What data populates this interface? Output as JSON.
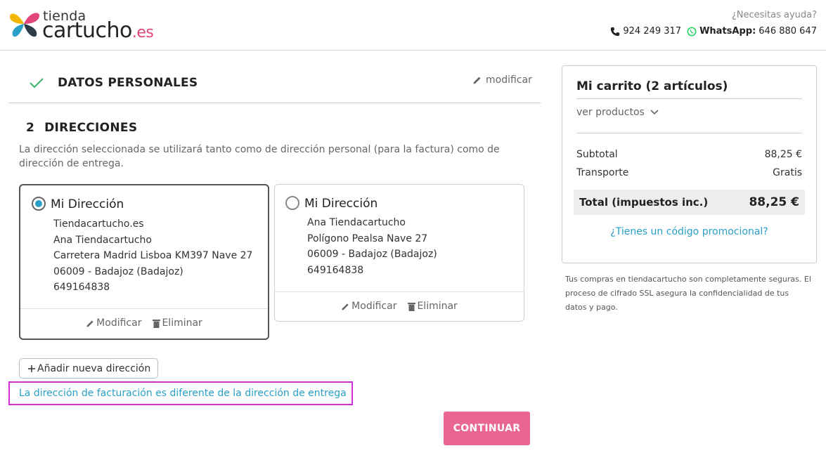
{
  "header": {
    "logo_small": "tienda",
    "logo_big": "cartucho",
    "logo_tld": ".es",
    "help_text": "¿Necesitas ayuda?",
    "phone": "924 249 317",
    "whatsapp_label": "WhatsApp:",
    "whatsapp_number": "646 880 647"
  },
  "step1": {
    "title": "DATOS PERSONALES",
    "modify_label": "modificar"
  },
  "step2": {
    "number": "2",
    "title": "DIRECCIONES",
    "description": "La dirección seleccionada se utilizará tanto como de dirección personal (para la factura) como de dirección de entrega."
  },
  "addresses": [
    {
      "alias": "Mi Dirección",
      "selected": true,
      "lines": [
        "Tiendacartucho.es",
        "Ana Tiendacartucho",
        "Carretera Madrid Lisboa KM397 Nave 27",
        "06009 - Badajoz (Badajoz)",
        "649164838"
      ],
      "edit_label": "Modificar",
      "delete_label": "Eliminar"
    },
    {
      "alias": "Mi Dirección",
      "selected": false,
      "lines": [
        "Ana Tiendacartucho",
        "Polígono Pealsa Nave 27",
        "06009 - Badajoz (Badajoz)",
        "649164838"
      ],
      "edit_label": "Modificar",
      "delete_label": "Eliminar"
    }
  ],
  "add_address_label": "Añadir nueva dirección",
  "billing_different_label": "La dirección de facturación es diferente de la dirección de entrega",
  "continue_label": "CONTINUAR",
  "cart": {
    "title": "Mi carrito (2 artículos)",
    "view_products": "ver productos",
    "subtotal_label": "Subtotal",
    "subtotal_value": "88,25 €",
    "shipping_label": "Transporte",
    "shipping_value": "Gratis",
    "total_label": "Total (impuestos inc.)",
    "total_value": "88,25 €",
    "promo_label": "¿Tienes un código promocional?"
  },
  "secure_note": "Tus compras en tiendacartucho son completamente seguras. El proceso de cifrado SSL asegura la confidencialidad de tus datos y pago.",
  "colors": {
    "accent_pink": "#e96594",
    "link_blue": "#2aa0c8",
    "check_green": "#3cb371",
    "highlight_magenta": "#d42bd4"
  }
}
